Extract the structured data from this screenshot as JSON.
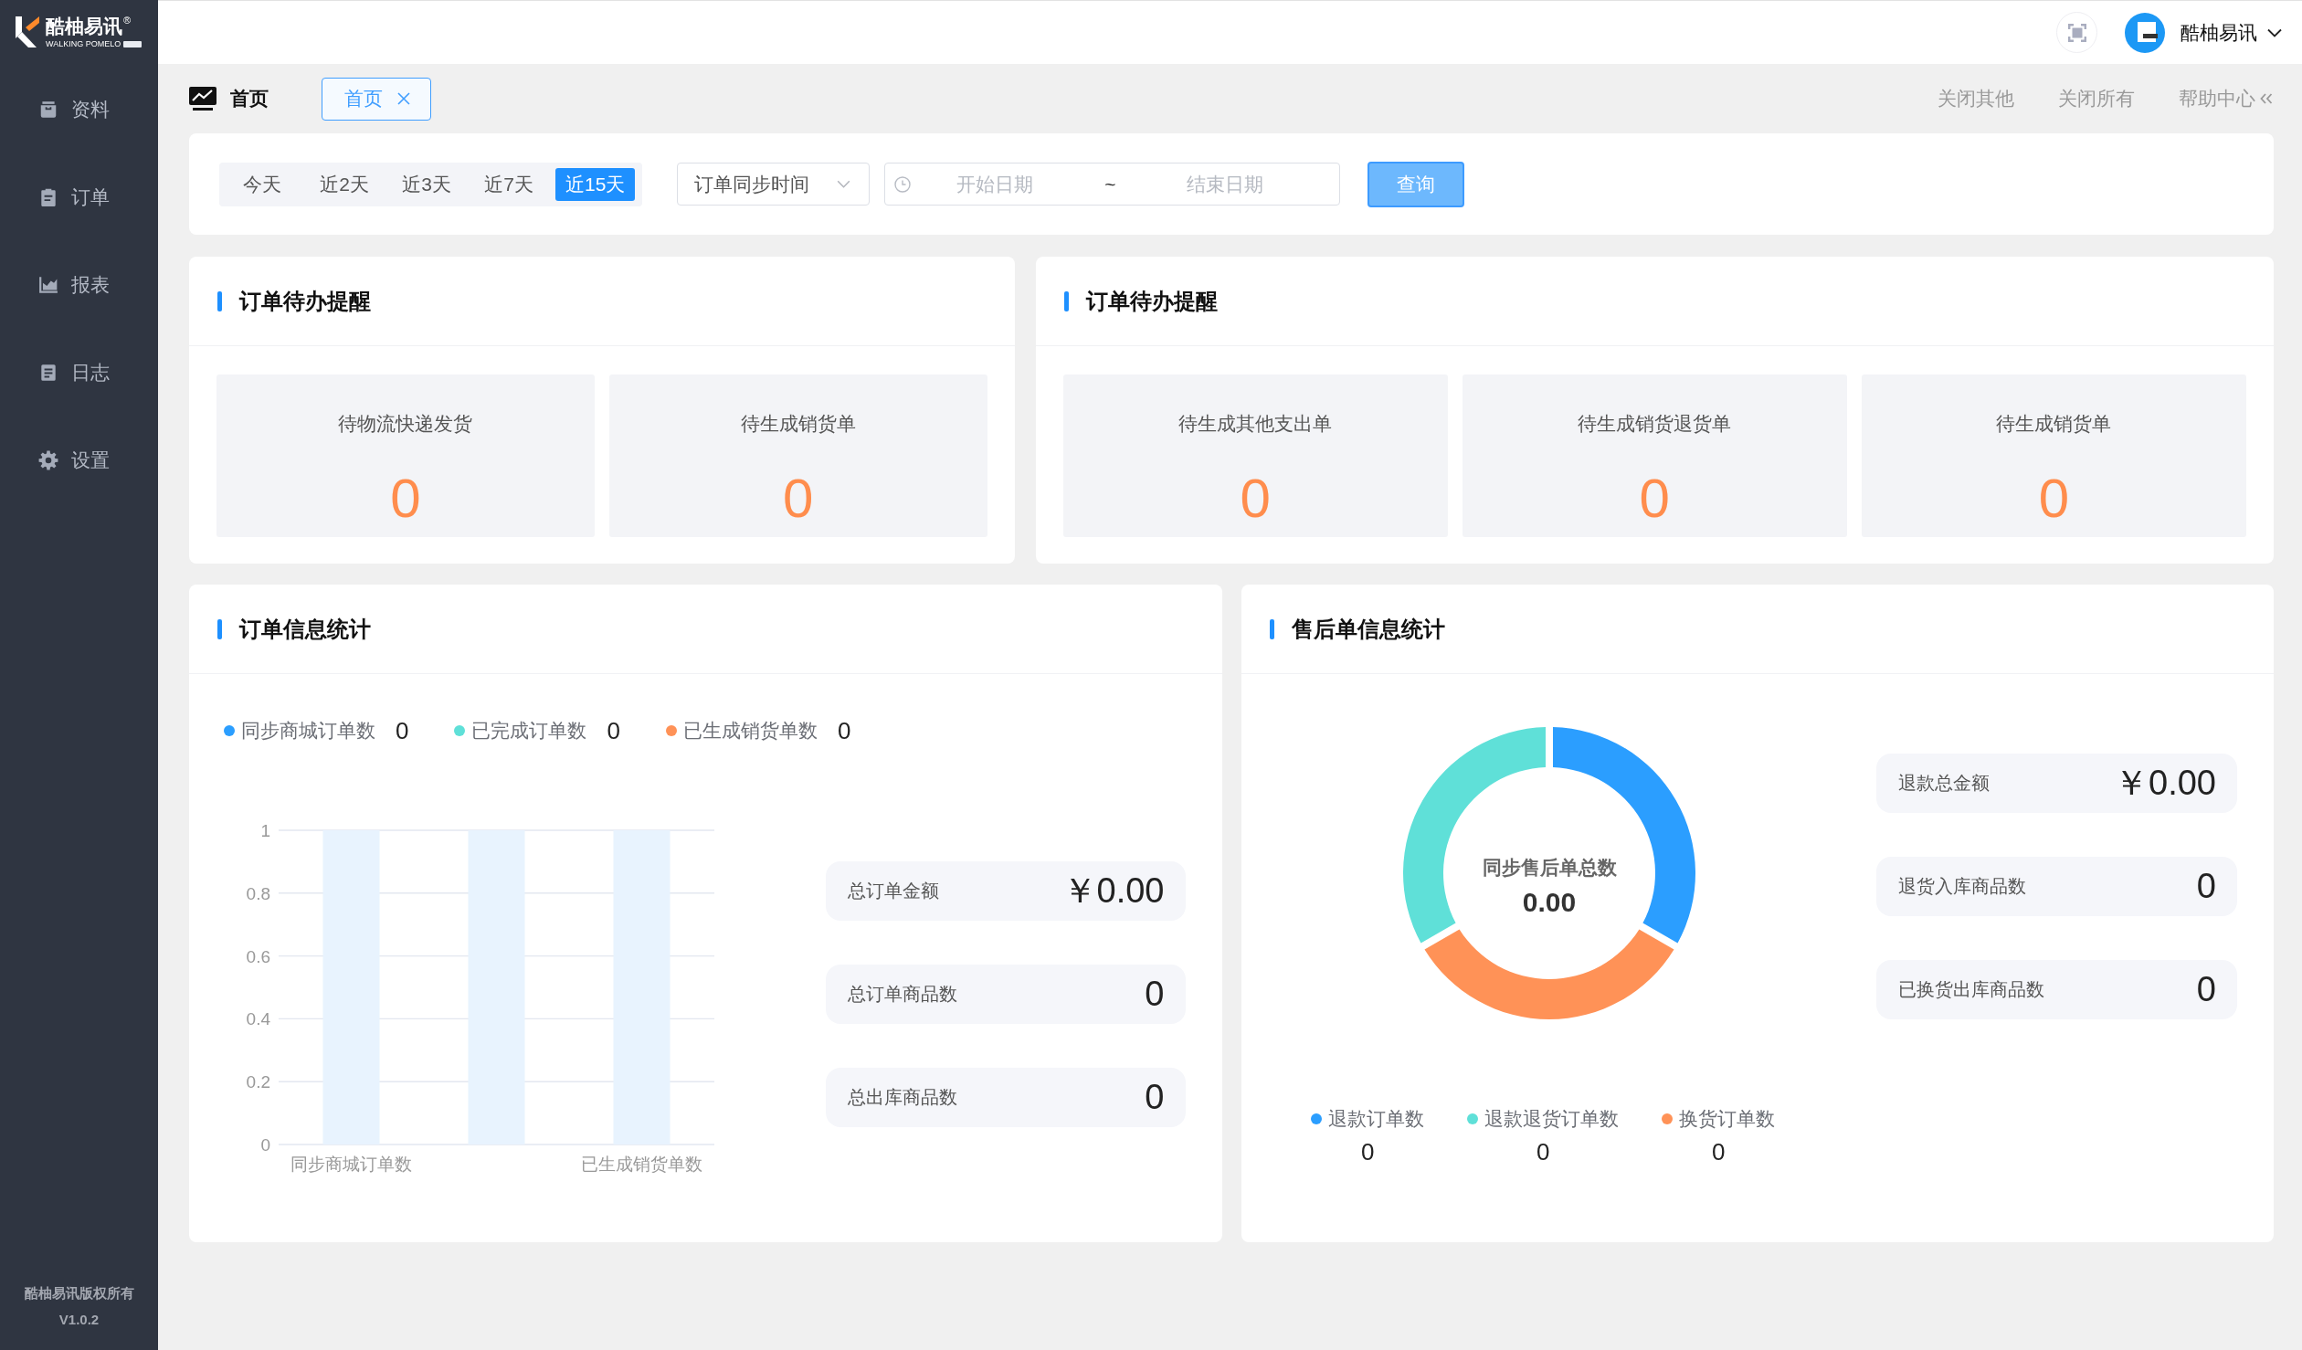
{
  "sidebar": {
    "logo": {
      "name": "酷柚易讯",
      "mark": "®",
      "tagline": "WALKING POMELO"
    },
    "items": [
      {
        "label": "资料"
      },
      {
        "label": "订单"
      },
      {
        "label": "报表"
      },
      {
        "label": "日志"
      },
      {
        "label": "设置"
      }
    ],
    "footer": {
      "copyright": "酷柚易讯版权所有",
      "version": "V1.0.2"
    }
  },
  "header": {
    "user": "酷柚易讯"
  },
  "tab_bar": {
    "page_title": "首页",
    "tabs": [
      {
        "label": "首页",
        "selected": true
      }
    ],
    "actions": [
      "关闭其他",
      "关闭所有",
      "帮助中心"
    ]
  },
  "filter": {
    "ranges": [
      {
        "label": "今天",
        "selected": false
      },
      {
        "label": "近2天",
        "selected": false
      },
      {
        "label": "近3天",
        "selected": false
      },
      {
        "label": "近7天",
        "selected": false
      },
      {
        "label": "近15天",
        "selected": true
      }
    ],
    "time_field": {
      "value": "订单同步时间"
    },
    "date_range": {
      "start_placeholder": "开始日期",
      "separator": "~",
      "end_placeholder": "结束日期"
    },
    "query_button": "查询"
  },
  "reminders": [
    {
      "title": "订单待办提醒",
      "tiles": [
        {
          "label": "待物流快递发货",
          "value": "0"
        },
        {
          "label": "待生成销货单",
          "value": "0"
        }
      ]
    },
    {
      "title": "订单待办提醒",
      "tiles": [
        {
          "label": "待生成其他支出单",
          "value": "0"
        },
        {
          "label": "待生成销货退货单",
          "value": "0"
        },
        {
          "label": "待生成销货单",
          "value": "0"
        }
      ]
    }
  ],
  "order_stats": {
    "title": "订单信息统计",
    "legend": [
      {
        "label": "同步商城订单数",
        "value": "0",
        "color": "#2b9eff"
      },
      {
        "label": "已完成订单数",
        "value": "0",
        "color": "#5fe0d8"
      },
      {
        "label": "已生成销货单数",
        "value": "0",
        "color": "#ff9257"
      }
    ],
    "chart_data": {
      "type": "bar",
      "categories": [
        "同步商城订单数",
        null,
        "已生成销货单数"
      ],
      "series": [
        {
          "color": "#e8f3fe",
          "values": [
            1,
            1,
            1
          ]
        },
        {
          "color": "#2b9eff",
          "values": [
            0,
            0,
            0
          ]
        }
      ],
      "ylim": [
        0,
        1
      ],
      "yticks": [
        0,
        0.2,
        0.4,
        0.6,
        0.8,
        1
      ],
      "grid": true
    },
    "totals": [
      {
        "label": "总订单金额",
        "value": "￥0.00"
      },
      {
        "label": "总订单商品数",
        "value": "0"
      },
      {
        "label": "总出库商品数",
        "value": "0"
      }
    ]
  },
  "aftersale_stats": {
    "title": "售后单信息统计",
    "donut": {
      "label": "同步售后单总数",
      "value": "0.00"
    },
    "legend": [
      {
        "label": "退款订单数",
        "value": "0",
        "color": "#2b9eff"
      },
      {
        "label": "退款退货订单数",
        "value": "0",
        "color": "#5fe0d8"
      },
      {
        "label": "换货订单数",
        "value": "0",
        "color": "#ff9257"
      }
    ],
    "totals": [
      {
        "label": "退款总金额",
        "value": "￥0.00"
      },
      {
        "label": "退货入库商品数",
        "value": "0"
      },
      {
        "label": "已换货出库商品数",
        "value": "0"
      }
    ]
  }
}
